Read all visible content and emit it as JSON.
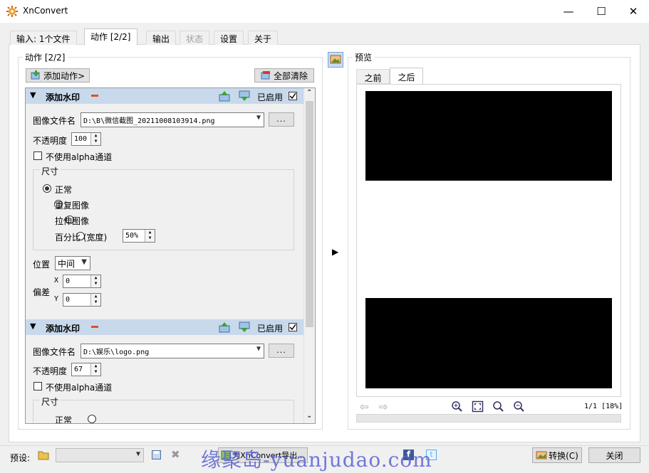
{
  "window": {
    "title": "XnConvert",
    "minimize": "—",
    "maximize": "☐",
    "close": "✕"
  },
  "tabs": [
    {
      "label": "输入: 1个文件"
    },
    {
      "label": "动作 [2/2]"
    },
    {
      "label": "输出"
    },
    {
      "label": "状态"
    },
    {
      "label": "设置"
    },
    {
      "label": "关于"
    }
  ],
  "actions_panel": {
    "title": "动作 [2/2]",
    "add_action": "添加动作>",
    "clear_all": "全部清除"
  },
  "actions": [
    {
      "name": "添加水印",
      "enabled_label": "已启用",
      "image_file_label": "图像文件名",
      "image_file": "D:\\B\\微信截图_20211008103914.png",
      "opacity_label": "不透明度",
      "opacity": "100",
      "no_alpha_label": "不使用alpha通道",
      "size_title": "尺寸",
      "size_options": [
        "正常",
        "重复图像",
        "拉伸图像",
        "百分比 (宽度)"
      ],
      "percent": "50%",
      "position_label": "位置",
      "position": "中间",
      "offset_label": "偏差",
      "x_label": "X",
      "x": "0",
      "y_label": "Y",
      "y": "0"
    },
    {
      "name": "添加水印",
      "enabled_label": "已启用",
      "image_file_label": "图像文件名",
      "image_file": "D:\\娱乐\\logo.png",
      "opacity_label": "不透明度",
      "opacity": "67",
      "no_alpha_label": "不使用alpha通道",
      "size_title": "尺寸",
      "size_options": [
        "正常"
      ]
    }
  ],
  "preview": {
    "title": "预览",
    "tab_before": "之前",
    "tab_after": "之后",
    "page_info": "1/1 [18%]"
  },
  "footer": {
    "preset_label": "预设:",
    "export_label": "为XnConvert导出...",
    "convert": "转换(C)",
    "close": "关闭"
  },
  "watermark": "缘聚岛-yuanjudao.com",
  "colors": {
    "action_header": "#c9d9ec",
    "panel": "#ffffff",
    "window_bg": "#f0f0f0"
  }
}
